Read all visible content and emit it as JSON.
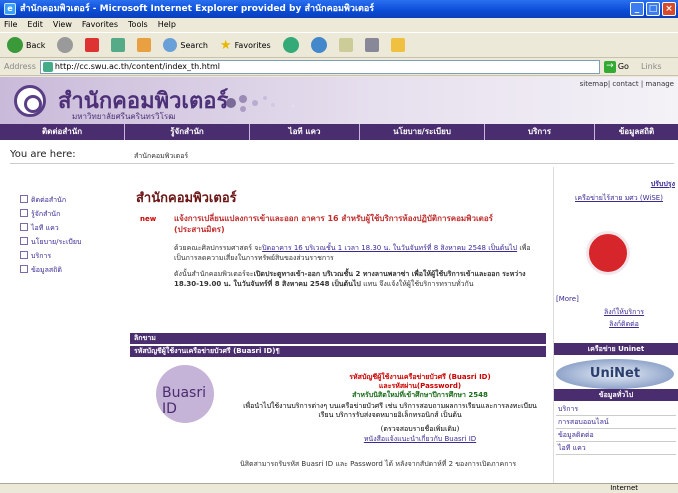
{
  "window": {
    "title": "สำนักคอมพิวเตอร์ - Microsoft Internet Explorer provided by สำนักคอมพิวเตอร์"
  },
  "menu": [
    "File",
    "Edit",
    "View",
    "Favorites",
    "Tools",
    "Help"
  ],
  "toolbar": {
    "back": "Back",
    "search": "Search",
    "favorites": "Favorites"
  },
  "address": {
    "label": "Address",
    "url": "http://cc.swu.ac.th/content/index_th.html",
    "go": "Go",
    "links": "Links"
  },
  "site": {
    "title": "สำนักคอมพิวเตอร์",
    "subtitle": "มหาวิทยาลัยศรีนครินทรวิโรฒ",
    "toplinks": "sitemap| contact | manage"
  },
  "nav": [
    "ติดต่อสำนัก",
    "รู้จักสำนัก",
    "ไอที แคว",
    "นโยบาย/ระเบียบ",
    "บริการ",
    "ข้อมูลสถิติ"
  ],
  "crumb": {
    "label": "You are here:",
    "path": "สำนักคอมพิวเตอร์"
  },
  "leftnav": [
    "ติดต่อสำนัก",
    "รู้จักสำนัก",
    "ไอที แคว",
    "นโยบาย/ระเบียบ",
    "บริการ",
    "ข้อมูลสถิติ"
  ],
  "main": {
    "heading": "สำนักคอมพิวเตอร์",
    "new_badge": "new",
    "news1": "แจ้งการเปลี่ยนแปลงการเข้าและออก อาคาร 16 สำหรับผู้ใช้บริการห้องปฏิบัติการคอมพิวเตอร์ (ประสานมิตร)",
    "p1a": "ด้วยคณะศิลปกรรมศาสตร์ จะ",
    "p1link": "ปิดอาคาร 16 บริเวณชั้น 1 เวลา 18.30 น. ในวันจันทร์ที่ 8 สิงหาคม 2548 เป็นต้นไป",
    "p1b": " เพื่อเป็นการลดความเสี่ยงในการทรัพย์สินของส่วนราชการ",
    "p2a": "ดังนั้นสำนักคอมพิวเตอร์จะ",
    "p2bold": "เปิดประตูทางเข้า-ออก บริเวณชั้น 2 ทางลานพลาซ่า เพื่อให้ผู้ใช้บริการเข้าและออก ระหว่าง 18.30-19.00 น. ในวันจันทร์ที่ 8 สิงหาคม 2548 เป็นต้นไป",
    "p2b": " แทน จึงแจ้งให้ผู้ใช้บริการทราบทั่วกัน",
    "sec1": "ลิกขาม",
    "sec2": "รหัสบัญชีผู้ใช้งานเครือข่ายบัวศรี (Buasri ID)¶",
    "buasri": "Buasri ID",
    "b_red1": "รหัสบัญชีผู้ใช้งานเครือข่ายบัวศรี (Buasri ID)",
    "b_red2": "และรหัสผ่าน(Password)",
    "b_green": "สำหรับนิสิตใหม่ที่เข้าศึกษาปีการศึกษา 2548",
    "b_text": "เพื่อนำไปใช้งานบริการต่างๆ บนเครือข่ายบัวศรี เช่น บริการสอบถามผลการเรียนและการลงทะเบียนเรียน บริการรับส่งจดหมายอิเล็กทรอนิกส์ เป็นต้น",
    "b_link1": "(ตรวจสอบรายชื่อเพิ่มเติม)",
    "b_link2": "หนังสือแจ้งแนะนำเกี่ยวกับ Buasri ID",
    "bottom": "นิสิตสามารถรับรหัส Buasri ID และ Password ได้ หลังจากสัปดาห์ที่ 2 ของการเปิดภาคการ"
  },
  "right": {
    "more_link": "ปรับปรุง",
    "wise": "เครือข่ายไร้สาย มศว (WiSE)",
    "more": "[More]",
    "link1": "ลิงก์ให้บริการ",
    "link2": "ลิงก์ติดต่อ",
    "uninet_title": "เครือข่าย Uninet",
    "uninet": "UniNet",
    "general": "ข้อมูลทั่วไป",
    "list": [
      "บริการ",
      "การสอบออนไลน์",
      "ข้อมูลติดต่อ",
      "ไอที แคว"
    ]
  },
  "status": "Internet"
}
